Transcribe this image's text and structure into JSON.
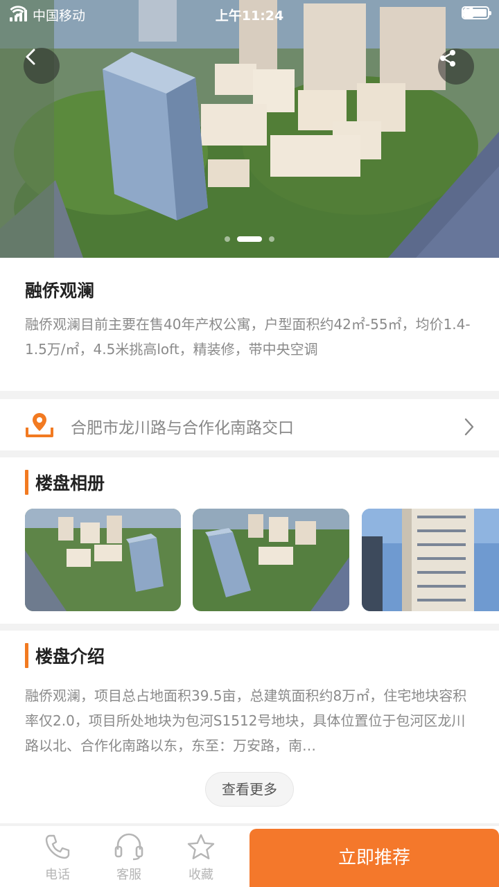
{
  "status_bar": {
    "carrier": "中国移动",
    "time": "上午11:24"
  },
  "hero": {
    "slide_count": 3,
    "active_slide": 2
  },
  "project": {
    "name": "融侨观澜",
    "summary": "融侨观澜目前主要在售40年产权公寓，户型面积约42㎡-55㎡，均价1.4-1.5万/㎡，4.5米挑高loft，精装修，带中央空调"
  },
  "address": {
    "text": "合肥市龙川路与合作化南路交口"
  },
  "album": {
    "title": "楼盘相册"
  },
  "intro": {
    "title": "楼盘介绍",
    "body": " 融侨观澜，项目总占地面积39.5亩，总建筑面积约8万㎡，住宅地块容积率仅2.0，项目所处地块为包河S1512号地块，具体位置位于包河区龙川路以北、合作化南路以东，东至：万安路，南…",
    "more_label": "查看更多"
  },
  "bottom_bar": {
    "phone_label": "电话",
    "service_label": "客服",
    "favorite_label": "收藏",
    "recommend_label": "立即推荐"
  },
  "colors": {
    "accent": "#f4782b",
    "section_bar": "#f27a21"
  }
}
